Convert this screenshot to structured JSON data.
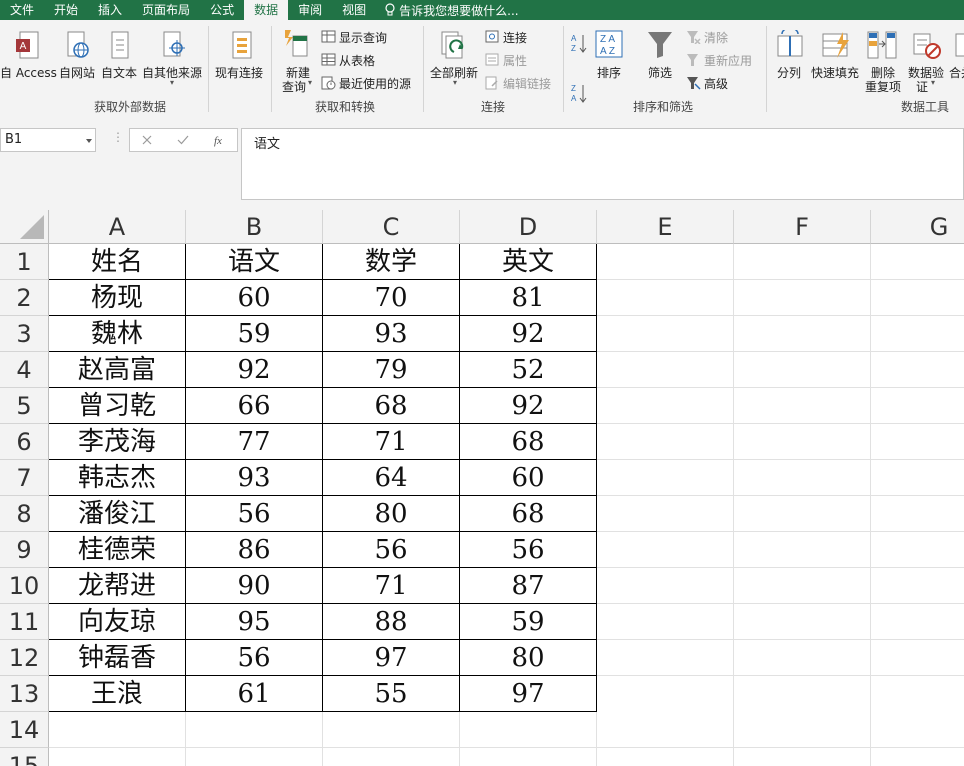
{
  "tabs": [
    "文件",
    "开始",
    "插入",
    "页面布局",
    "公式",
    "数据",
    "审阅",
    "视图"
  ],
  "active_tab": "数据",
  "tell_me": "告诉我您想要做什么...",
  "ribbon": {
    "get_external": {
      "buttons": [
        "自 Access",
        "自网站",
        "自文本",
        "自其他来源",
        "现有连接"
      ],
      "group": "获取外部数据"
    },
    "get_transform": {
      "new_query_line1": "新建",
      "new_query_line2": "查询",
      "small": [
        "显示查询",
        "从表格",
        "最近使用的源"
      ],
      "group": "获取和转换"
    },
    "connections": {
      "refresh_all": "全部刷新",
      "small": [
        "连接",
        "属性",
        "编辑链接"
      ],
      "group": "连接"
    },
    "sort_filter": {
      "sort": "排序",
      "filter": "筛选",
      "small": [
        "清除",
        "重新应用",
        "高级"
      ],
      "group": "排序和筛选"
    },
    "data_tools": {
      "split": "分列",
      "flash_fill": "快速填充",
      "remove_dup_line1": "删除",
      "remove_dup_line2": "重复项",
      "validation_line1": "数据验",
      "validation_line2": "证",
      "consolidate": "合并",
      "group": "数据工具"
    }
  },
  "formula_bar": {
    "name_box": "B1",
    "formula": "语文"
  },
  "columns": [
    "A",
    "B",
    "C",
    "D",
    "E",
    "F",
    "G"
  ],
  "rows": [
    "1",
    "2",
    "3",
    "4",
    "5",
    "6",
    "7",
    "8",
    "9",
    "10",
    "11",
    "12",
    "13",
    "14",
    "15"
  ],
  "table": {
    "header": [
      "姓名",
      "语文",
      "数学",
      "英文"
    ],
    "data": [
      [
        "杨现",
        "60",
        "70",
        "81"
      ],
      [
        "魏林",
        "59",
        "93",
        "92"
      ],
      [
        "赵高富",
        "92",
        "79",
        "52"
      ],
      [
        "曾习乾",
        "66",
        "68",
        "92"
      ],
      [
        "李茂海",
        "77",
        "71",
        "68"
      ],
      [
        "韩志杰",
        "93",
        "64",
        "60"
      ],
      [
        "潘俊江",
        "56",
        "80",
        "68"
      ],
      [
        "桂德荣",
        "86",
        "56",
        "56"
      ],
      [
        "龙帮进",
        "90",
        "71",
        "87"
      ],
      [
        "向友琼",
        "95",
        "88",
        "59"
      ],
      [
        "钟磊香",
        "56",
        "97",
        "80"
      ],
      [
        "王浪",
        "61",
        "55",
        "97"
      ]
    ]
  },
  "colors": {
    "excel_green": "#217346",
    "ribbon_bg": "#f3f3f3",
    "header_bg": "#f3f3f3"
  }
}
